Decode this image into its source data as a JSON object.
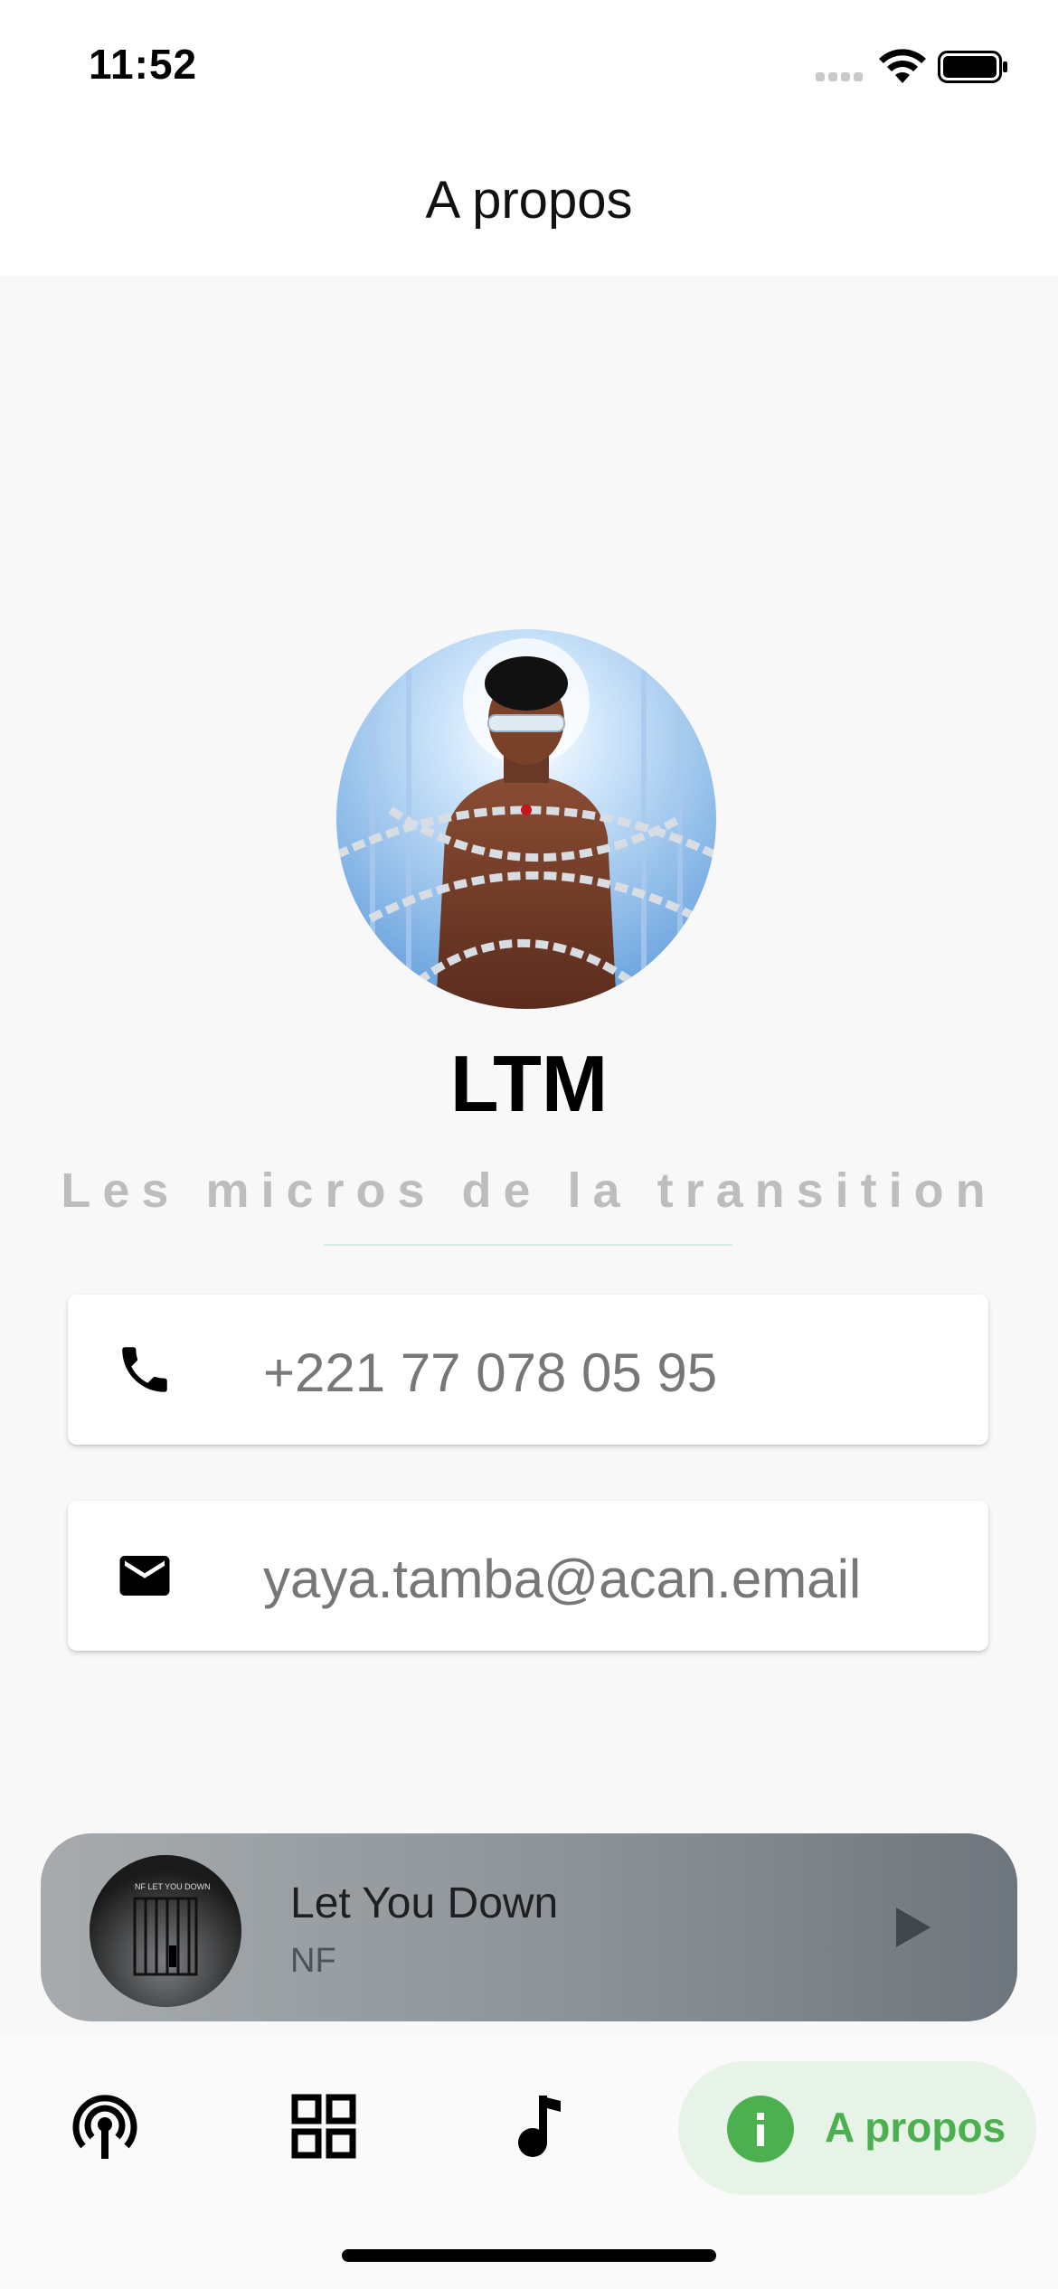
{
  "status_bar": {
    "time": "11:52"
  },
  "header": {
    "title": "A propos"
  },
  "profile": {
    "name": "LTM",
    "tagline": "Les micros de la transition"
  },
  "contacts": [
    {
      "icon": "phone-icon",
      "value": "+221 77 078 05 95"
    },
    {
      "icon": "email-icon",
      "value": "yaya.tamba@acan.email"
    }
  ],
  "player": {
    "track_title": "Let You Down",
    "artist": "NF",
    "cover_text": "NF  LET YOU DOWN"
  },
  "bottom_nav": {
    "items": [
      {
        "icon": "podcast-icon"
      },
      {
        "icon": "grid-icon"
      },
      {
        "icon": "music-note-icon"
      },
      {
        "icon": "info-icon",
        "label": "A propos",
        "active": true
      }
    ]
  },
  "colors": {
    "accent": "#4caf50",
    "accent_bg": "#e8f3e8"
  }
}
